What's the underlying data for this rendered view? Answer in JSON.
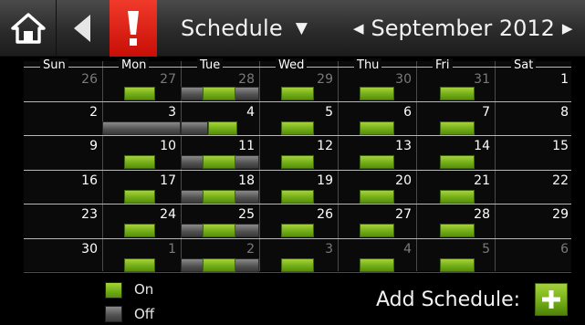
{
  "header": {
    "schedule_label": "Schedule",
    "month_label": "September 2012",
    "icons": [
      "home-icon",
      "back-icon",
      "alert-icon",
      "dropdown-caret-icon",
      "prev-month-icon",
      "next-month-icon"
    ]
  },
  "calendar": {
    "weekdays": [
      "Sun",
      "Mon",
      "Tue",
      "Wed",
      "Thu",
      "Fri",
      "Sat"
    ],
    "weeks": [
      [
        "26",
        "27",
        "28",
        "29",
        "30",
        "31",
        "1"
      ],
      [
        "2",
        "3",
        "4",
        "5",
        "6",
        "7",
        "8"
      ],
      [
        "9",
        "10",
        "11",
        "12",
        "13",
        "14",
        "15"
      ],
      [
        "16",
        "17",
        "18",
        "19",
        "20",
        "21",
        "22"
      ],
      [
        "23",
        "24",
        "25",
        "26",
        "27",
        "28",
        "29"
      ],
      [
        "30",
        "1",
        "2",
        "3",
        "4",
        "5",
        "6"
      ]
    ],
    "dim_days": [
      [
        0,
        0
      ],
      [
        0,
        1
      ],
      [
        0,
        2
      ],
      [
        0,
        3
      ],
      [
        0,
        4
      ],
      [
        0,
        5
      ],
      [
        5,
        1
      ],
      [
        5,
        2
      ],
      [
        5,
        3
      ],
      [
        5,
        4
      ],
      [
        5,
        5
      ],
      [
        5,
        6
      ]
    ]
  },
  "legend": {
    "on_label": "On",
    "off_label": "Off"
  },
  "actions": {
    "add_schedule_label": "Add Schedule:"
  },
  "colors": {
    "on": "#6fab15",
    "off": "#505050",
    "alert": "#e0180c"
  }
}
